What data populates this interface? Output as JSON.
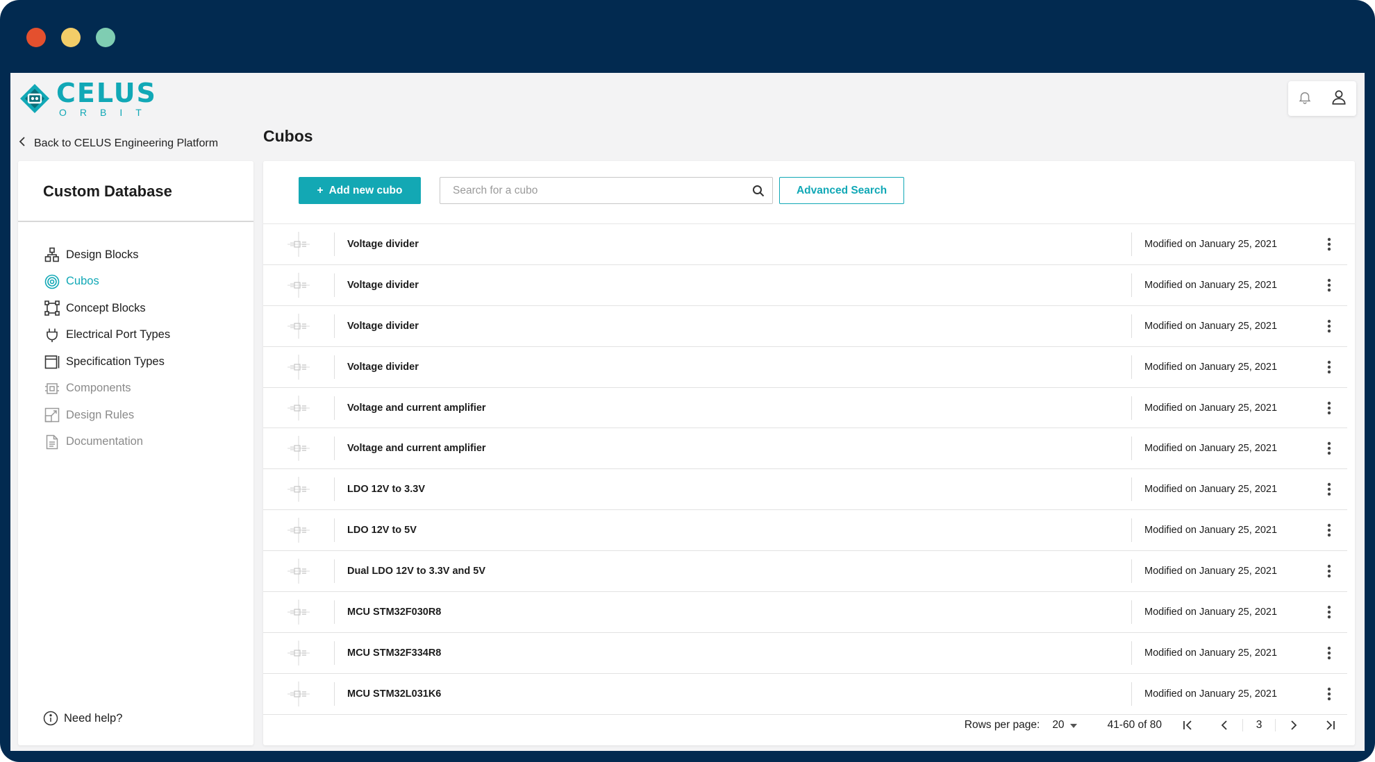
{
  "window": {
    "controls": [
      {
        "name": "close",
        "color": "#e4502e"
      },
      {
        "name": "minimize",
        "color": "#f3cd68"
      },
      {
        "name": "maximize",
        "color": "#7fcdb2"
      }
    ]
  },
  "brand": {
    "name": "CELUS",
    "sub": "ORBIT",
    "accent": "#11a8b6"
  },
  "header": {
    "back_label": "Back to CELUS Engineering Platform",
    "page_title": "Cubos"
  },
  "sidebar": {
    "title": "Custom Database",
    "items": [
      {
        "label": "Design Blocks",
        "icon": "design-blocks-icon",
        "state": "normal"
      },
      {
        "label": "Cubos",
        "icon": "cubos-icon",
        "state": "active"
      },
      {
        "label": "Concept Blocks",
        "icon": "concept-blocks-icon",
        "state": "normal"
      },
      {
        "label": "Electrical Port Types",
        "icon": "plug-icon",
        "state": "normal"
      },
      {
        "label": "Specification Types",
        "icon": "specification-icon",
        "state": "normal"
      },
      {
        "label": "Components",
        "icon": "chip-icon",
        "state": "disabled"
      },
      {
        "label": "Design Rules",
        "icon": "design-rules-icon",
        "state": "disabled"
      },
      {
        "label": "Documentation",
        "icon": "document-icon",
        "state": "disabled"
      }
    ],
    "help_label": "Need help?"
  },
  "toolbar": {
    "add_label": "Add new cubo",
    "search_placeholder": "Search for a cubo",
    "advanced_label": "Advanced Search"
  },
  "rows": [
    {
      "name": "Voltage divider",
      "modified": "Modified on January 25, 2021"
    },
    {
      "name": "Voltage divider",
      "modified": "Modified on January 25, 2021"
    },
    {
      "name": "Voltage divider",
      "modified": "Modified on January 25, 2021"
    },
    {
      "name": "Voltage divider",
      "modified": "Modified on January 25, 2021"
    },
    {
      "name": "Voltage and current amplifier",
      "modified": "Modified on January 25, 2021"
    },
    {
      "name": "Voltage and current amplifier",
      "modified": "Modified on January 25, 2021"
    },
    {
      "name": "LDO 12V to 3.3V",
      "modified": "Modified on January 25, 2021"
    },
    {
      "name": "LDO 12V to 5V",
      "modified": "Modified on January 25, 2021"
    },
    {
      "name": "Dual LDO 12V to 3.3V and 5V",
      "modified": "Modified on January 25, 2021"
    },
    {
      "name": "MCU STM32F030R8",
      "modified": "Modified on January 25, 2021"
    },
    {
      "name": "MCU STM32F334R8",
      "modified": "Modified on January 25, 2021"
    },
    {
      "name": "MCU STM32L031K6",
      "modified": "Modified on January 25, 2021"
    }
  ],
  "pagination": {
    "rows_per_page_label": "Rows per page:",
    "rows_per_page_value": "20",
    "range": "41-60 of 80",
    "current_page": "3"
  }
}
